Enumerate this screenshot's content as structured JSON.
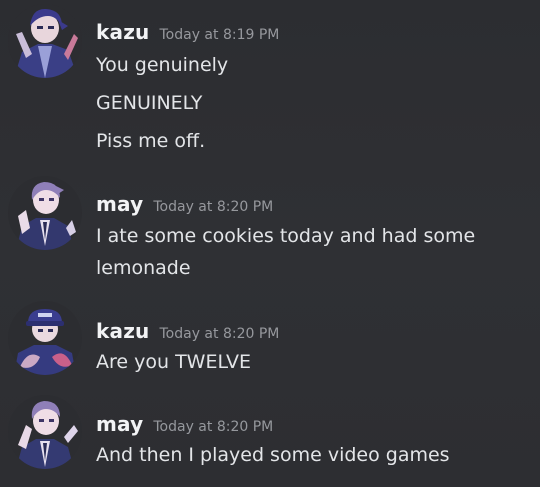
{
  "messages": [
    {
      "username": "kazu",
      "timestamp": "Today at 8:19 PM",
      "avatar_icon": "kazu-avatar-icon",
      "lines": [
        "You genuinely",
        "GENUINELY",
        "Piss me off."
      ]
    },
    {
      "username": "may",
      "timestamp": "Today at 8:20 PM",
      "avatar_icon": "may-avatar-icon",
      "lines": [
        "I ate some cookies today and had some",
        "lemonade"
      ]
    },
    {
      "username": "kazu",
      "timestamp": "Today at 8:20 PM",
      "avatar_icon": "kazu-avatar-icon",
      "lines": [
        "Are you TWELVE"
      ]
    },
    {
      "username": "may",
      "timestamp": "Today at 8:20 PM",
      "avatar_icon": "may-avatar-icon",
      "lines": [
        "And then I played some video games"
      ]
    }
  ],
  "colors": {
    "background": "#2e2f33",
    "username": "#f2f3f5",
    "timestamp": "#96989d",
    "message_text": "#e3e5e8"
  }
}
